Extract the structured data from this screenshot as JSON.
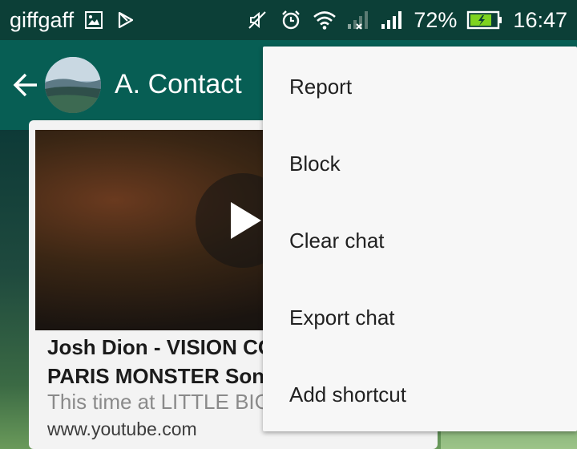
{
  "status_bar": {
    "carrier": "giffgaff",
    "battery_percent": "72%",
    "time": "16:47",
    "left_icons": [
      "image-icon",
      "play-store-icon"
    ],
    "right_icons": [
      "mute-icon",
      "alarm-icon",
      "wifi-icon",
      "signal-icon-1",
      "signal-icon-2",
      "battery-icon"
    ]
  },
  "app_bar": {
    "contact_name": "A. Contact"
  },
  "message": {
    "link_title": "Josh Dion - VISION COMES SAVIOR",
    "link_title_line2": "PARIS MONSTER Sonic Session",
    "link_description": "This time at LITTLE BIG STUDIO",
    "link_url": "www.youtube.com"
  },
  "menu": {
    "items": [
      {
        "label": "Report"
      },
      {
        "label": "Block"
      },
      {
        "label": "Clear chat"
      },
      {
        "label": "Export chat"
      },
      {
        "label": "Add shortcut"
      }
    ]
  },
  "colors": {
    "status_bar": "#0c3f37",
    "app_bar": "#075e54",
    "battery_fill": "#7ed321"
  }
}
